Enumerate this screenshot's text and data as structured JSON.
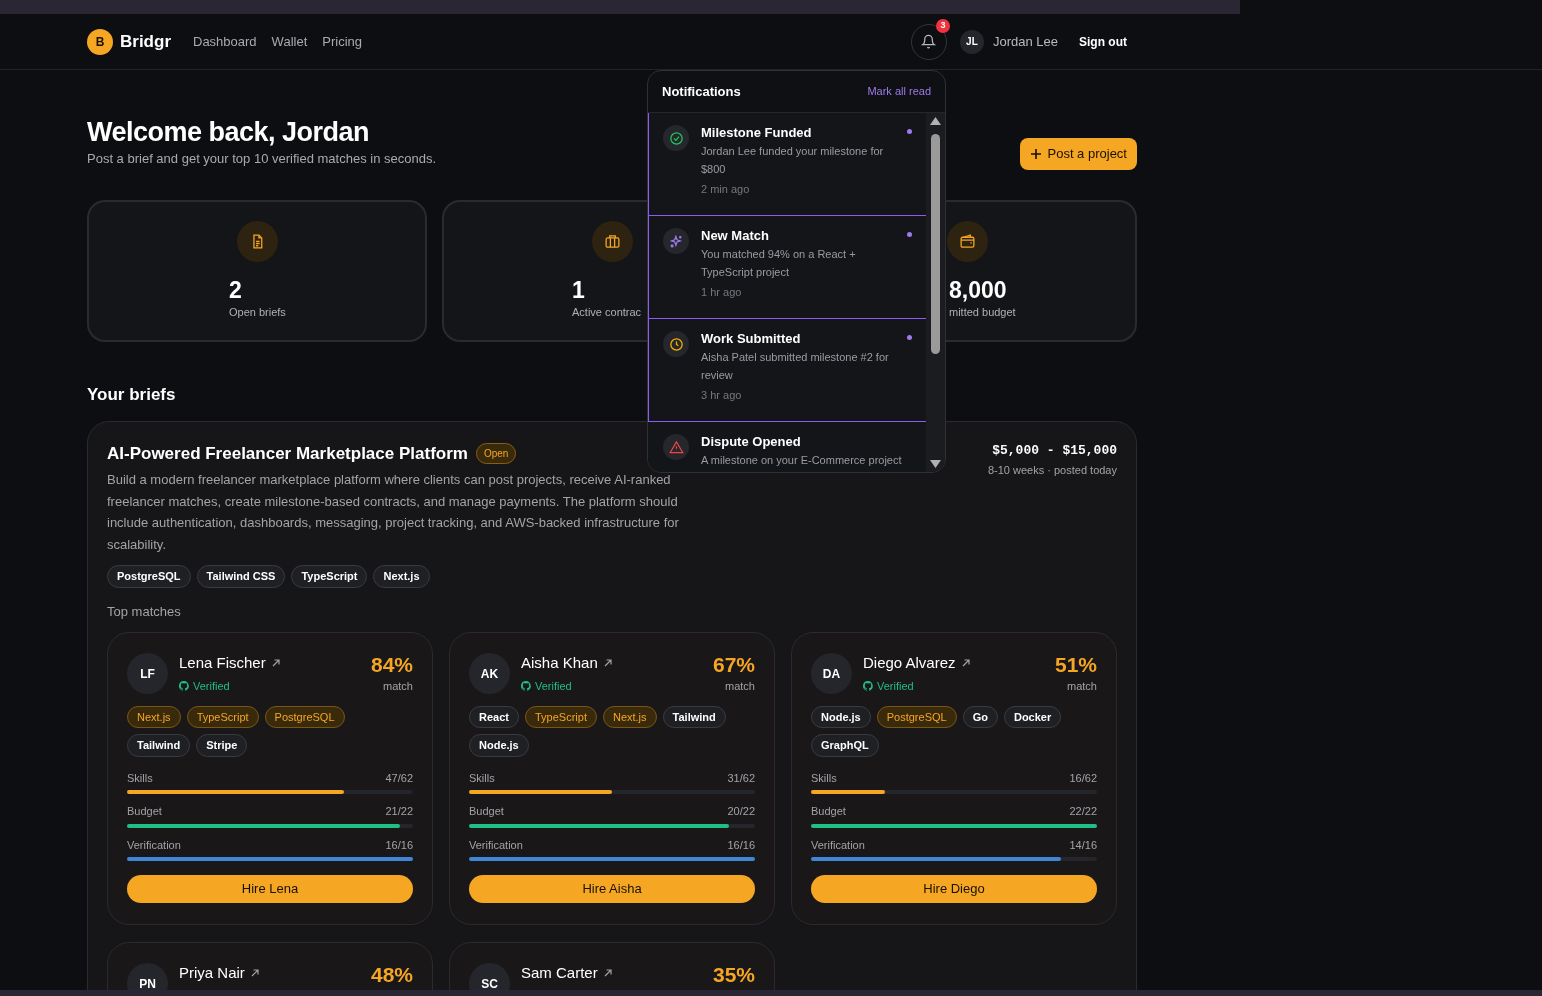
{
  "nav": {
    "logo_letter": "B",
    "brand": "Bridgr",
    "links": [
      {
        "label": "Dashboard"
      },
      {
        "label": "Wallet"
      },
      {
        "label": "Pricing"
      }
    ],
    "notification_count": "3",
    "user_initials": "JL",
    "user_name": "Jordan Lee",
    "sign_out": "Sign out"
  },
  "header": {
    "title": "Welcome back, Jordan",
    "subtitle": "Post a brief and get your top 10 verified matches in seconds.",
    "action": "Post a project"
  },
  "stats": [
    {
      "kind": "briefs",
      "value": "2",
      "label": "Open briefs"
    },
    {
      "kind": "contracts",
      "value": "1",
      "label": "Active contrac"
    },
    {
      "kind": "budget",
      "value": "8,000",
      "label": "mitted budget"
    }
  ],
  "briefs_title": "Your briefs",
  "brief": {
    "title": "AI-Powered Freelancer Marketplace Platform",
    "status": "Open",
    "budget": "$5,000 - $15,000",
    "meta": "8-10 weeks · posted today",
    "description": "Build a modern freelancer marketplace platform where clients can post projects, receive AI-ranked freelancer matches, create milestone-based contracts, and manage payments. The platform should include authentication, dashboards, messaging, project tracking, and AWS-backed infrastructure for scalability.",
    "tags": [
      "PostgreSQL",
      "Tailwind CSS",
      "TypeScript",
      "Next.js"
    ],
    "matches_title": "Top matches",
    "matches": [
      {
        "initials": "LF",
        "name": "Lena Fischer",
        "verified": "Verified",
        "match": "84%",
        "match_label": "match",
        "skills": [
          {
            "label": "Next.js",
            "matched": true
          },
          {
            "label": "TypeScript",
            "matched": true
          },
          {
            "label": "PostgreSQL",
            "matched": true
          },
          {
            "label": "Tailwind",
            "matched": false
          },
          {
            "label": "Stripe",
            "matched": false
          }
        ],
        "scores": [
          {
            "kind": "skills",
            "label": "Skills",
            "value": "47/62",
            "level": 0.76
          },
          {
            "kind": "budget",
            "label": "Budget",
            "value": "21/22",
            "level": 0.955
          },
          {
            "kind": "verification",
            "label": "Verification",
            "value": "16/16",
            "level": 1
          }
        ],
        "action": "Hire Lena"
      },
      {
        "initials": "AK",
        "name": "Aisha Khan",
        "verified": "Verified",
        "match": "67%",
        "match_label": "match",
        "skills": [
          {
            "label": "React",
            "matched": false
          },
          {
            "label": "TypeScript",
            "matched": true
          },
          {
            "label": "Next.js",
            "matched": true
          },
          {
            "label": "Tailwind",
            "matched": false
          },
          {
            "label": "Node.js",
            "matched": false
          }
        ],
        "scores": [
          {
            "kind": "skills",
            "label": "Skills",
            "value": "31/62",
            "level": 0.5
          },
          {
            "kind": "budget",
            "label": "Budget",
            "value": "20/22",
            "level": 0.91
          },
          {
            "kind": "verification",
            "label": "Verification",
            "value": "16/16",
            "level": 1
          }
        ],
        "action": "Hire Aisha"
      },
      {
        "initials": "DA",
        "name": "Diego Alvarez",
        "verified": "Verified",
        "match": "51%",
        "match_label": "match",
        "skills": [
          {
            "label": "Node.js",
            "matched": false
          },
          {
            "label": "PostgreSQL",
            "matched": true
          },
          {
            "label": "Go",
            "matched": false
          },
          {
            "label": "Docker",
            "matched": false
          },
          {
            "label": "GraphQL",
            "matched": false
          }
        ],
        "scores": [
          {
            "kind": "skills",
            "label": "Skills",
            "value": "16/62",
            "level": 0.26
          },
          {
            "kind": "budget",
            "label": "Budget",
            "value": "22/22",
            "level": 1
          },
          {
            "kind": "verification",
            "label": "Verification",
            "value": "14/16",
            "level": 0.875
          }
        ],
        "action": "Hire Diego"
      },
      {
        "initials": "PN",
        "name": "Priya Nair",
        "match": "48%"
      },
      {
        "initials": "SC",
        "name": "Sam Carter",
        "match": "35%"
      }
    ]
  },
  "notifications": {
    "title": "Notifications",
    "mark_all": "Mark all read",
    "items": [
      {
        "kind": "funded",
        "title": "Milestone Funded",
        "body": "Jordan Lee funded your milestone for $800",
        "time": "2 min ago",
        "unread": true
      },
      {
        "kind": "match",
        "title": "New Match",
        "body": "You matched 94% on a React + TypeScript project",
        "time": "1 hr ago",
        "unread": true
      },
      {
        "kind": "submitted",
        "title": "Work Submitted",
        "body": "Aisha Patel submitted milestone #2 for review",
        "time": "3 hr ago",
        "unread": true
      },
      {
        "kind": "dispute",
        "title": "Dispute Opened",
        "body": "A milestone on your E-Commerce project",
        "unread": false
      }
    ]
  }
}
